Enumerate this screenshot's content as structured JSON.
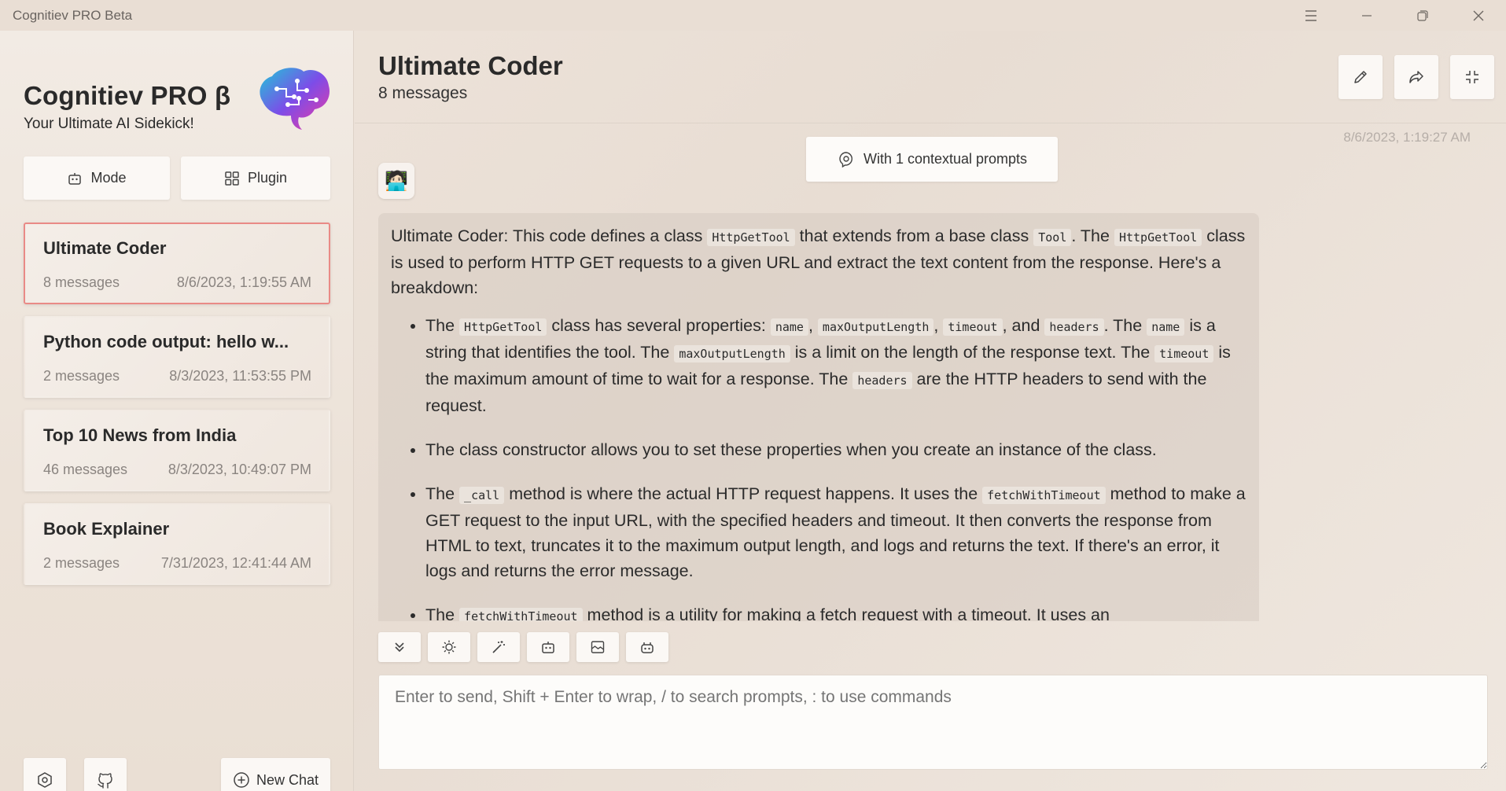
{
  "window": {
    "title": "Cognitiev PRO Beta"
  },
  "sidebar": {
    "brand_title": "Cognitiev PRO β",
    "brand_subtitle": "Your Ultimate AI Sidekick!",
    "mode_label": "Mode",
    "plugin_label": "Plugin",
    "chats": [
      {
        "title": "Ultimate Coder",
        "count": "8 messages",
        "date": "8/6/2023, 1:19:55 AM"
      },
      {
        "title": "Python code output: hello w...",
        "count": "2 messages",
        "date": "8/3/2023, 11:53:55 PM"
      },
      {
        "title": "Top 10 News from India",
        "count": "46 messages",
        "date": "8/3/2023, 10:49:07 PM"
      },
      {
        "title": "Book Explainer",
        "count": "2 messages",
        "date": "7/31/2023, 12:41:44 AM"
      }
    ],
    "new_chat_label": "New Chat"
  },
  "header": {
    "title": "Ultimate Coder",
    "subtitle": "8 messages"
  },
  "chat": {
    "timestamp": "8/6/2023, 1:19:27 AM",
    "context_prompts_label": "With 1 contextual prompts",
    "avatar": "🧑🏻‍💻",
    "message": {
      "intro_1": "Ultimate Coder: This code defines a class",
      "code_httpgettool": "HttpGetTool",
      "intro_2": "that extends from a base class",
      "code_tool": "Tool",
      "intro_3": ". The",
      "intro_4": "class is used to perform HTTP GET requests to a given URL and extract the text content from the response. Here's a breakdown:",
      "b1_1": "The",
      "b1_2": "class has several properties:",
      "code_name": "name",
      "comma": ",",
      "code_maxoutputlength": "maxOutputLength",
      "code_timeout": "timeout",
      "b1_and": ", and",
      "code_headers": "headers",
      "b1_3": ". The",
      "b1_4": "is a string that identifies the tool. The",
      "b1_5": "is a limit on the length of the response text. The",
      "b1_6": "is the maximum amount of time to wait for a response. The",
      "b1_7": "are the HTTP headers to send with the request.",
      "b2": "The class constructor allows you to set these properties when you create an instance of the class.",
      "b3_1": "The",
      "code_call": "_call",
      "b3_2": "method is where the actual HTTP request happens. It uses the",
      "code_fetchwithtimeout": "fetchWithTimeout",
      "b3_3": "method to make a GET request to the input URL, with the specified headers and timeout. It then converts the response from HTML to text, truncates it to the maximum output length, and logs and returns the text. If there's an error, it logs and returns the error message.",
      "b4_1": "The",
      "b4_2": "method is a utility for making a fetch request with a timeout. It uses an"
    }
  },
  "composer": {
    "placeholder": "Enter to send, Shift + Enter to wrap, / to search prompts, : to use commands"
  }
}
